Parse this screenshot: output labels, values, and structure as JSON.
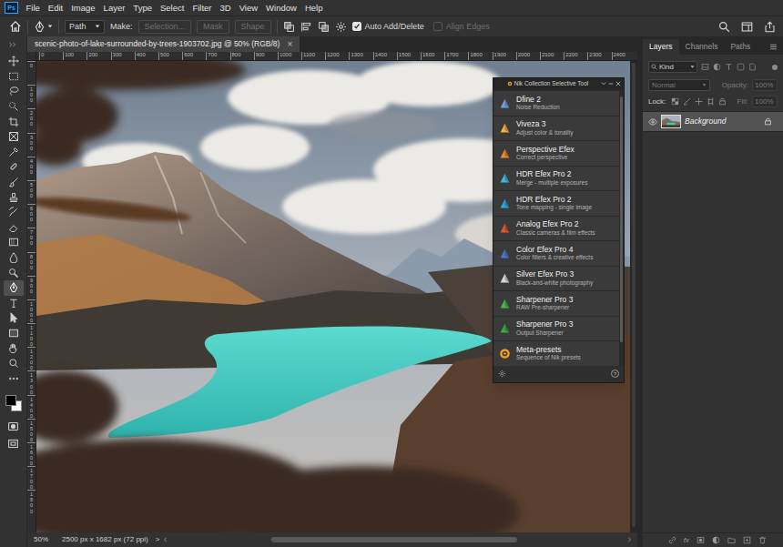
{
  "menu_bar": {
    "logo": "Ps",
    "items": [
      "File",
      "Edit",
      "Image",
      "Layer",
      "Type",
      "Select",
      "Filter",
      "3D",
      "View",
      "Window",
      "Help"
    ]
  },
  "options_bar": {
    "tool_mode": "Path",
    "make_label": "Make:",
    "buttons": [
      {
        "label": "Selection...",
        "disabled": true
      },
      {
        "label": "Mask",
        "disabled": true
      },
      {
        "label": "Shape",
        "disabled": true
      }
    ],
    "auto_add_delete": {
      "label": "Auto Add/Delete",
      "checked": true
    },
    "align_edges": {
      "label": "Align Edges",
      "checked": false,
      "disabled": true
    }
  },
  "document_tab": {
    "title": "scenic-photo-of-lake-surrounded-by-trees-1903702.jpg @ 50% (RGB/8)",
    "close": "×"
  },
  "rulers": {
    "horizontal": [
      "0",
      "100",
      "200",
      "300",
      "400",
      "500",
      "600",
      "700",
      "800",
      "900",
      "1000",
      "1100",
      "1200",
      "1300",
      "1400",
      "1500",
      "1600",
      "1700",
      "1800",
      "1900",
      "2000",
      "2100",
      "2200",
      "2300",
      "2400"
    ],
    "vertical": [
      "0",
      "100",
      "200",
      "300",
      "400",
      "500",
      "600",
      "700",
      "800",
      "900",
      "1000",
      "1100",
      "1200",
      "1300",
      "1400",
      "1500",
      "1600",
      "1700",
      "1800"
    ]
  },
  "toolbar": {
    "tools": [
      {
        "selected": false
      },
      {
        "selected": false
      },
      {
        "selected": false
      },
      {
        "selected": false
      },
      {
        "selected": false
      },
      {
        "selected": false
      },
      {
        "selected": false
      },
      {
        "selected": false
      },
      {
        "selected": false
      },
      {
        "selected": false
      },
      {
        "selected": false
      },
      {
        "selected": false
      },
      {
        "selected": false
      },
      {
        "selected": false
      },
      {
        "selected": false
      },
      {
        "selected": true
      },
      {
        "selected": false
      },
      {
        "selected": false
      },
      {
        "selected": false
      },
      {
        "selected": false
      },
      {
        "selected": false
      },
      {
        "selected": false
      }
    ],
    "foreground_color": "#000000",
    "background_color": "#ffffff"
  },
  "nik_panel": {
    "title": "Nik Collection Selective Tool",
    "items": [
      {
        "name": "Dfine 2",
        "description": "Noise Reduction",
        "color": "#6f9fd8",
        "kind": "effect"
      },
      {
        "name": "Viveza 3",
        "description": "Adjust color & tonality",
        "color": "#f2b233",
        "kind": "effect"
      },
      {
        "name": "Perspective Efex",
        "description": "Correct perspective",
        "color": "#e98b2e",
        "kind": "effect"
      },
      {
        "name": "HDR Efex Pro 2",
        "description": "Merge - multiple exposures",
        "color": "#3fb6e0",
        "kind": "effect"
      },
      {
        "name": "HDR Efex Pro 2",
        "description": "Tone mapping - single image",
        "color": "#2aa7d9",
        "kind": "effect"
      },
      {
        "name": "Analog Efex Pro 2",
        "description": "Classic cameras & film effects",
        "color": "#e4572e",
        "kind": "effect"
      },
      {
        "name": "Color Efex Pro 4",
        "description": "Color filters & creative effects",
        "color": "#4a78d0",
        "kind": "effect"
      },
      {
        "name": "Silver Efex Pro 3",
        "description": "Black-and-white photography",
        "color": "#d9d9d9",
        "kind": "effect"
      },
      {
        "name": "Sharpener Pro 3",
        "description": "RAW Pre-sharpener",
        "color": "#4cb84a",
        "kind": "effect"
      },
      {
        "name": "Sharpener Pro 3",
        "description": "Output Sharpener",
        "color": "#3aa845",
        "kind": "effect"
      },
      {
        "name": "Meta-presets",
        "description": "Sequence of Nik presets",
        "color": "#f0a21e",
        "kind": "preset"
      }
    ],
    "help": "?"
  },
  "layers_panel": {
    "tabs": [
      {
        "label": "Layers",
        "selected": true
      },
      {
        "label": "Channels",
        "selected": false
      },
      {
        "label": "Paths",
        "selected": false
      }
    ],
    "filter_kind": "Kind",
    "blend_mode": "Normal",
    "opacity": {
      "label": "Opacity:",
      "value": "100%",
      "disabled": true
    },
    "lock_label": "Lock:",
    "fill": {
      "label": "Fill:",
      "value": "100%",
      "disabled": true
    },
    "layers": [
      {
        "name": "Background",
        "selected": true,
        "visible": true,
        "locked": true
      }
    ],
    "footer_fx": "fx"
  },
  "status_bar": {
    "zoom": "50%",
    "document_info": "2500 px x 1682 px (72 ppi)",
    "menu_arrow": ">"
  }
}
